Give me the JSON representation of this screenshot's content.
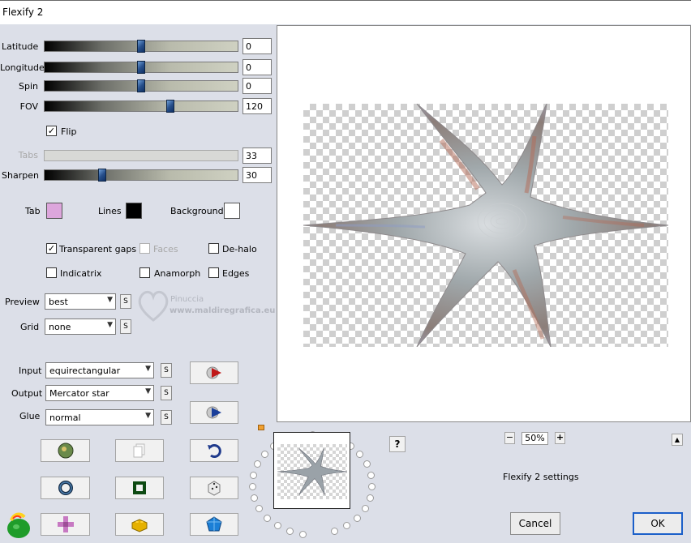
{
  "window": {
    "title": "Flexify 2"
  },
  "sliders": [
    {
      "label": "Latitude",
      "value": "0",
      "level": 0.5,
      "enabled": true
    },
    {
      "label": "Longitude",
      "value": "0",
      "level": 0.5,
      "enabled": true
    },
    {
      "label": "Spin",
      "value": "0",
      "level": 0.5,
      "enabled": true
    },
    {
      "label": "FOV",
      "value": "120",
      "level": 0.65,
      "enabled": true
    },
    {
      "label": "Tabs",
      "value": "33",
      "level": 0.0,
      "enabled": false
    },
    {
      "label": "Sharpen",
      "value": "30",
      "level": 0.3,
      "enabled": true
    }
  ],
  "flip": {
    "label": "Flip",
    "checked": true
  },
  "colors": {
    "tab": {
      "label": "Tab",
      "color": "#dda6dc"
    },
    "lines": {
      "label": "Lines",
      "color": "#000000"
    },
    "background": {
      "label": "Background",
      "color": "#ffffff"
    }
  },
  "checkboxes": {
    "transparent_gaps": {
      "label": "Transparent gaps",
      "checked": true
    },
    "faces": {
      "label": "Faces",
      "checked": false,
      "enabled": false
    },
    "de_halo": {
      "label": "De-halo",
      "checked": false
    },
    "indicatrix": {
      "label": "Indicatrix",
      "checked": false
    },
    "anamorph": {
      "label": "Anamorph",
      "checked": false
    },
    "edges": {
      "label": "Edges",
      "checked": false
    }
  },
  "preview_select": {
    "label": "Preview",
    "value": "best"
  },
  "grid_select": {
    "label": "Grid",
    "value": "none"
  },
  "input_select": {
    "label": "Input",
    "value": "equirectangular"
  },
  "output_select": {
    "label": "Output",
    "value": "Mercator star"
  },
  "glue_select": {
    "label": "Glue",
    "value": "normal"
  },
  "s_button_label": "S",
  "watermark": {
    "line1": "Pinuccia",
    "line2": "www.maldiregrafica.eu"
  },
  "zoom": {
    "minus": "−",
    "value": "50%",
    "plus": "+"
  },
  "help_label": "?",
  "collapse_label": "▲",
  "settings_label": "Flexify 2 settings",
  "cancel_label": "Cancel",
  "ok_label": "OK",
  "icons": {
    "tool_buttons": [
      "globe-icon",
      "copy-icon",
      "undo-icon",
      "ring-icon",
      "square-icon",
      "dice-icon",
      "plugin-icon",
      "fabric-icon",
      "brick-icon",
      "gem-icon"
    ],
    "app_logo": "flexify-logo-icon"
  }
}
